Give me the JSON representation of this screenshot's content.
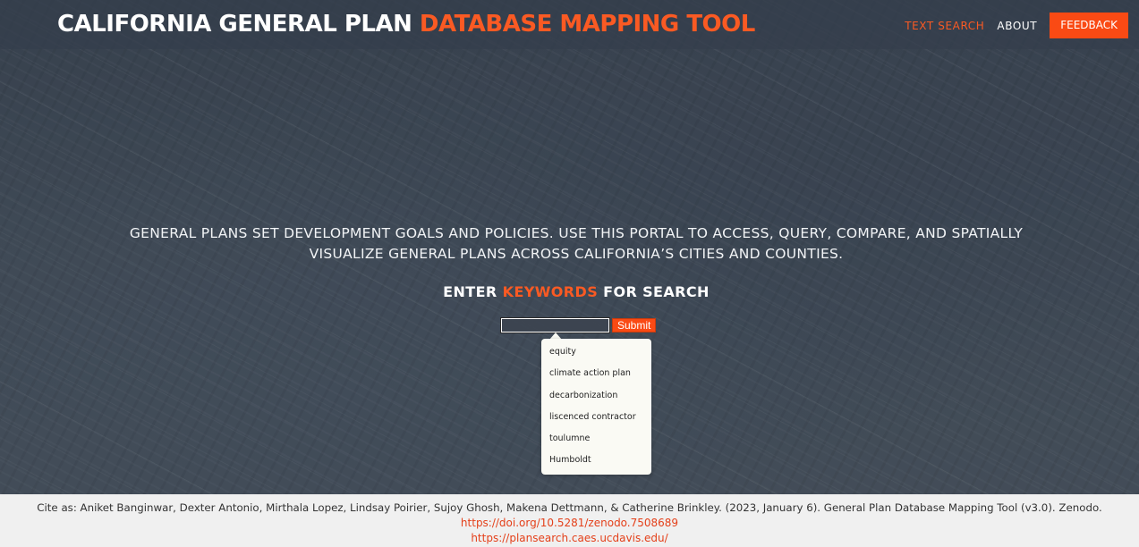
{
  "navbar": {
    "brand_primary": "CALIFORNIA GENERAL PLAN",
    "brand_accent": "DATABASE MAPPING TOOL",
    "links": [
      {
        "label": "TEXT SEARCH",
        "active": true
      },
      {
        "label": "ABOUT",
        "active": false
      }
    ],
    "feedback_label": "FEEDBACK"
  },
  "hero": {
    "intro": "GENERAL PLANS SET DEVELOPMENT GOALS AND POLICIES. USE THIS PORTAL TO ACCESS, QUERY, COMPARE, AND SPATIALLY VISUALIZE GENERAL PLANS ACROSS CALIFORNIA’S CITIES AND COUNTIES.",
    "search_heading_pre": "ENTER ",
    "search_heading_accent": "KEYWORDS",
    "search_heading_post": " FOR SEARCH"
  },
  "search": {
    "value": "",
    "submit_label": "Submit",
    "suggestions": [
      "equity",
      "climate action plan",
      "decarbonization",
      "liscenced contractor",
      "toulumne",
      "Humboldt"
    ]
  },
  "footer": {
    "cite": "Cite as: Aniket Banginwar, Dexter Antonio, Mirthala Lopez, Lindsay Poirier, Sujoy Ghosh, Makena Dettmann, & Catherine Brinkley. (2023, January 6). General Plan Database Mapping Tool (v3.0). Zenodo.",
    "doi_link": "https://doi.org/10.5281/zenodo.7508689",
    "site_link": "https://plansearch.caes.ucdavis.edu/"
  },
  "colors": {
    "accent": "#fa5a23",
    "button": "#fa4a14",
    "link": "#e4401a"
  }
}
